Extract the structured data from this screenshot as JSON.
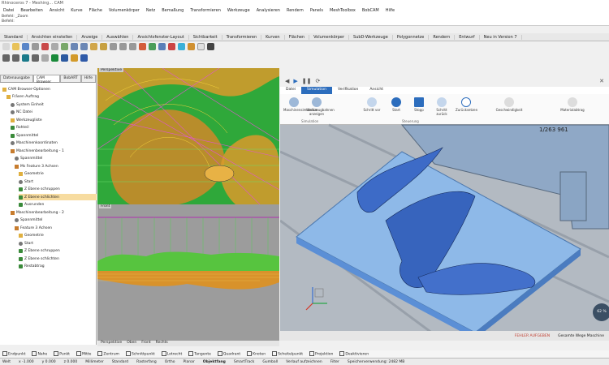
{
  "window": {
    "title": "Rhinoceros 7 - Meshing... CAM"
  },
  "menubar": [
    "Datei",
    "Bearbeiten",
    "Ansicht",
    "Kurve",
    "Fläche",
    "Volumenkörper",
    "Netz",
    "Bemaßung",
    "Transformieren",
    "Werkzeuge",
    "Analysieren",
    "Rendern",
    "Panels",
    "MeshToolbox",
    "BobCAM",
    "Hilfe"
  ],
  "command_history": [
    "Befehl: _Zoom",
    "Befehl:"
  ],
  "toolbar_tabs": [
    "Standard",
    "Ansichten einstellen",
    "Anzeige",
    "Auswählen",
    "Ansichtsfenster-Layout",
    "Sichtbarkeit",
    "Transformieren",
    "Kurven",
    "Flächen",
    "Volumenkörper",
    "SubD-Werkzeuge",
    "Polygonnetze",
    "Rendern",
    "Entwurf",
    "Neu in Version 7"
  ],
  "left_panel": {
    "tabs": [
      "Datenausgabe",
      "CAM Browser",
      "BobART",
      "Hilfe"
    ],
    "tree": [
      {
        "label": "CAM Browser-Optionen",
        "indent": 0,
        "icon": "folder"
      },
      {
        "label": "Fräsen Auftrag",
        "indent": 1,
        "icon": "folder"
      },
      {
        "label": "System Einheit",
        "indent": 2,
        "icon": "gear"
      },
      {
        "label": "NC Datei",
        "indent": 2,
        "icon": "gear"
      },
      {
        "label": "Werkzeugliste",
        "indent": 2,
        "icon": "folder"
      },
      {
        "label": "Rohteil",
        "indent": 2,
        "icon": "check"
      },
      {
        "label": "Spannmittel",
        "indent": 2,
        "icon": "check"
      },
      {
        "label": "Maschinenkoordinaten",
        "indent": 2,
        "icon": "gear"
      },
      {
        "label": "Maschinenbearbeitung - 1",
        "indent": 2,
        "icon": "tool"
      },
      {
        "label": "Spannmittel",
        "indent": 3,
        "icon": "gear"
      },
      {
        "label": "Ms Feature 3 Achsen",
        "indent": 3,
        "icon": "tool"
      },
      {
        "label": "Geometrie",
        "indent": 4,
        "icon": "folder"
      },
      {
        "label": "Start",
        "indent": 4,
        "icon": "gear"
      },
      {
        "label": "Z Ebene schruppen",
        "indent": 4,
        "icon": "check"
      },
      {
        "label": "Z Ebene schlichten",
        "indent": 4,
        "icon": "check",
        "selected": true
      },
      {
        "label": "Ausrunden",
        "indent": 4,
        "icon": "check"
      },
      {
        "label": "Maschinenbearbeitung - 2",
        "indent": 2,
        "icon": "tool"
      },
      {
        "label": "Spannmittel",
        "indent": 3,
        "icon": "gear"
      },
      {
        "label": "Feature 3 Achsen",
        "indent": 3,
        "icon": "tool"
      },
      {
        "label": "Geometrie",
        "indent": 4,
        "icon": "folder"
      },
      {
        "label": "Start",
        "indent": 4,
        "icon": "gear"
      },
      {
        "label": "Z Ebene schruppen",
        "indent": 4,
        "icon": "check"
      },
      {
        "label": "Z Ebene schlichten",
        "indent": 4,
        "icon": "check"
      },
      {
        "label": "Restabtrag",
        "indent": 4,
        "icon": "check"
      }
    ]
  },
  "viewports": {
    "top_label": "Perspektive",
    "bottom_label": "Front",
    "tabs": [
      "Perspektive",
      "Oben",
      "Front",
      "Rechts"
    ]
  },
  "cam_window": {
    "ribbon_tabs": [
      "Datei",
      "Simulation",
      "Verifikation",
      "Ansicht"
    ],
    "ribbon_groups": [
      "Simulation",
      "Steuerung"
    ],
    "ribbon_buttons": [
      "Maschinensimulation",
      "Werkzeugbahnen anzeigen",
      "Schritt vor",
      "Start",
      "Stopp",
      "Schritt zurück",
      "Zurücksetzen",
      "Geschwindigkeit",
      "Materialabtrag"
    ],
    "counter": "1/263 961",
    "error_text": "FEHLER AUFGEBEN",
    "status_text": "Gesamte Wege Maschine",
    "progress": "62 %"
  },
  "osnap": [
    "Endpunkt",
    "Nahe",
    "Punkt",
    "Mitte",
    "Zentrum",
    "Schnittpunkt",
    "Lotrecht",
    "Tangente",
    "Quadrant",
    "Knoten",
    "Scheitelpunkt",
    "Projektion",
    "Deaktivieren"
  ],
  "statusbar": {
    "items": [
      "Welt",
      "x -1.000",
      "y 0.000",
      "z 0.000",
      "Millimeter",
      "Standard"
    ],
    "toggles": [
      "Rasterfang",
      "Ortho",
      "Planar",
      "Objektfang",
      "SmartTrack",
      "Gumball",
      "Verlauf aufzeichnen",
      "Filter"
    ],
    "message": "Speicherverwendung: 2482 MB"
  },
  "colors": {
    "accent": "#2c6dbd",
    "model_green": "#2fa83a",
    "model_orange": "#d99a2b",
    "part_blue": "#5b8fd6"
  }
}
